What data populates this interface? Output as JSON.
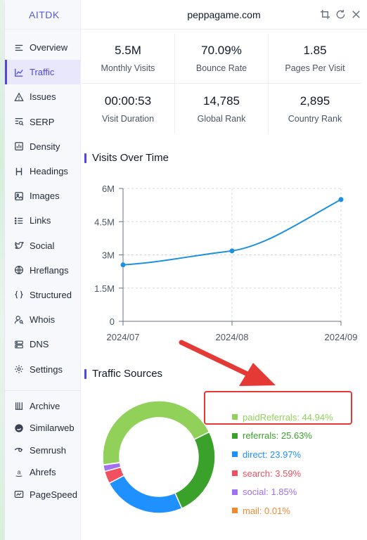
{
  "brand": "AITDK",
  "header": {
    "domain": "peppagame.com"
  },
  "sidebar": {
    "items": [
      {
        "label": "Overview",
        "icon": "overview-icon"
      },
      {
        "label": "Traffic",
        "icon": "traffic-icon",
        "active": true
      },
      {
        "label": "Issues",
        "icon": "warning-icon"
      },
      {
        "label": "SERP",
        "icon": "serp-icon"
      },
      {
        "label": "Density",
        "icon": "density-icon"
      },
      {
        "label": "Headings",
        "icon": "heading-icon"
      },
      {
        "label": "Images",
        "icon": "image-icon"
      },
      {
        "label": "Links",
        "icon": "links-icon"
      },
      {
        "label": "Social",
        "icon": "twitter-icon"
      },
      {
        "label": "Hreflangs",
        "icon": "globe-icon"
      },
      {
        "label": "Structured",
        "icon": "braces-icon"
      },
      {
        "label": "Whois",
        "icon": "user-search-icon"
      },
      {
        "label": "DNS",
        "icon": "dns-icon"
      },
      {
        "label": "Settings",
        "icon": "gear-icon"
      }
    ],
    "tools": [
      {
        "label": "Archive",
        "icon": "archive-icon"
      },
      {
        "label": "Similarweb",
        "icon": "similarweb-icon"
      },
      {
        "label": "Semrush",
        "icon": "semrush-icon"
      },
      {
        "label": "Ahrefs",
        "icon": "ahrefs-icon"
      },
      {
        "label": "PageSpeed",
        "icon": "pagespeed-icon"
      }
    ]
  },
  "stats": {
    "monthly_visits": {
      "value": "5.5M",
      "label": "Monthly Visits"
    },
    "bounce_rate": {
      "value": "70.09%",
      "label": "Bounce Rate"
    },
    "pages_per_visit": {
      "value": "1.85",
      "label": "Pages Per Visit"
    },
    "visit_duration": {
      "value": "00:00:53",
      "label": "Visit Duration"
    },
    "global_rank": {
      "value": "14,785",
      "label": "Global Rank"
    },
    "country_rank": {
      "value": "2,895",
      "label": "Country Rank"
    }
  },
  "sections": {
    "visits_title": "Visits Over Time",
    "sources_title": "Traffic Sources"
  },
  "chart_data": [
    {
      "type": "line",
      "x": [
        "2024/07",
        "2024/08",
        "2024/09"
      ],
      "series": [
        {
          "values": [
            2.55,
            3.18,
            5.5
          ]
        }
      ],
      "y_ticks": [
        "0",
        "1.5M",
        "3M",
        "4.5M",
        "6M"
      ],
      "ylim": [
        0,
        6
      ],
      "y_unit": "M",
      "grid": true,
      "color": "#1e90e0"
    },
    {
      "type": "pie",
      "donut": true,
      "slices": [
        {
          "label": "paidReferrals",
          "value": 44.94,
          "text": "paidReferrals: 44.94%",
          "color": "#91d15a"
        },
        {
          "label": "referrals",
          "value": 25.63,
          "text": "referrals: 25.63%",
          "color": "#3aa12b"
        },
        {
          "label": "direct",
          "value": 23.97,
          "text": "direct: 23.97%",
          "color": "#1e90ff"
        },
        {
          "label": "search",
          "value": 3.59,
          "text": "search: 3.59%",
          "color": "#f05060"
        },
        {
          "label": "social",
          "value": 1.85,
          "text": "social: 1.85%",
          "color": "#a070f0"
        },
        {
          "label": "mail",
          "value": 0.01,
          "text": "mail: 0.01%",
          "color": "#f08a30"
        }
      ],
      "legend": "right"
    }
  ],
  "colors": {
    "accent": "#4f46e5",
    "highlight": "#e53935"
  }
}
